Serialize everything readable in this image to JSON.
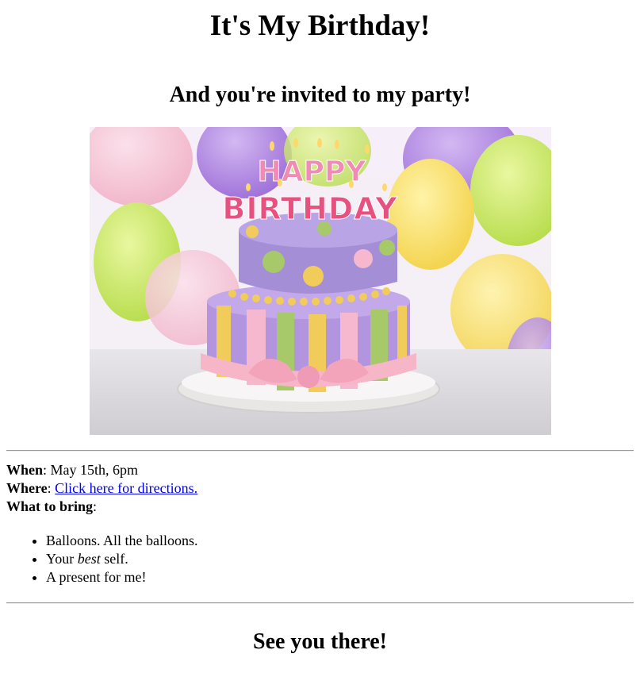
{
  "page": {
    "title": "It's My Birthday!",
    "subtitle": "And you're invited to my party!",
    "closing": "See you there!"
  },
  "image": {
    "alt": "Birthday cake",
    "candle_text_top": "HAPPY",
    "candle_text_bottom": "BIRTHDAY"
  },
  "details": {
    "when_label": "When",
    "when_value": "May 15th, 6pm",
    "where_label": "Where",
    "where_link": "Click here for directions.",
    "bring_label": "What to bring"
  },
  "bring_list": {
    "item1": "Balloons. All the balloons.",
    "item2_before": "Your ",
    "item2_em": "best",
    "item2_after": " self.",
    "item3": "A present for me!"
  },
  "colors": {
    "link": "#0000ee",
    "rule": "#9a9a9a",
    "cake_purple": "#a48fd6",
    "cake_pink": "#f5b8cf",
    "cake_green": "#a8c96a",
    "cake_yellow": "#f2cc5a"
  }
}
